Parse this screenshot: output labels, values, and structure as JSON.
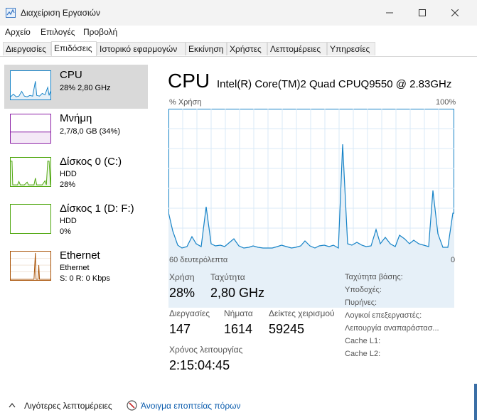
{
  "window": {
    "title": "Διαχείριση Εργασιών",
    "app_icon": "task-manager-icon"
  },
  "menu": [
    "Αρχείο",
    "Επιλογές",
    "Προβολή"
  ],
  "tabs": [
    "Διεργασίες",
    "Επιδόσεις",
    "Ιστορικό εφαρμογών",
    "Εκκίνηση",
    "Χρήστες",
    "Λεπτομέρειες",
    "Υπηρεσίες"
  ],
  "active_tab": "Επιδόσεις",
  "sidebar": [
    {
      "name": "CPU",
      "line1": "28% 2,80 GHz",
      "color": "#1683c7"
    },
    {
      "name": "Μνήμη",
      "line1": "2,7/8,0 GB (34%)",
      "color": "#8b1ea5"
    },
    {
      "name": "Δίσκος 0 (C:)",
      "line1": "HDD",
      "line2": "28%",
      "color": "#4da60c"
    },
    {
      "name": "Δίσκος 1 (D: F:)",
      "line1": "HDD",
      "line2": "0%",
      "color": "#4da60c"
    },
    {
      "name": "Ethernet",
      "line1": "Ethernet",
      "line2": "S: 0 R: 0 Kbps",
      "color": "#a74f01"
    }
  ],
  "main": {
    "title": "CPU",
    "model": "Intel(R) Core(TM)2 Quad CPUQ9550 @ 2.83GHz",
    "graph_top_left": "% Χρήση",
    "graph_top_right": "100%",
    "graph_bottom_left": "60 δευτερόλεπτα",
    "graph_bottom_right": "0",
    "stats": {
      "usage_label": "Χρήση",
      "usage_value": "28%",
      "speed_label": "Ταχύτητα",
      "speed_value": "2,80 GHz",
      "processes_label": "Διεργασίες",
      "processes_value": "147",
      "threads_label": "Νήματα",
      "threads_value": "1614",
      "handles_label": "Δείκτες χειρισμού",
      "handles_value": "59245",
      "uptime_label": "Χρόνος λειτουργίας",
      "uptime_value": "2:15:04:45"
    },
    "right_labels": [
      "Ταχύτητα βάσης:",
      "Υποδοχές:",
      "Πυρήνες:",
      "Λογικοί επεξεργαστές:",
      "Λειτουργία αναπαράστασ...",
      "Cache L1:",
      "Cache L2:"
    ]
  },
  "footer": {
    "less_details": "Λιγότερες λεπτομέρειες",
    "resource_monitor": "Άνοιγμα εποπτείας πόρων"
  }
}
